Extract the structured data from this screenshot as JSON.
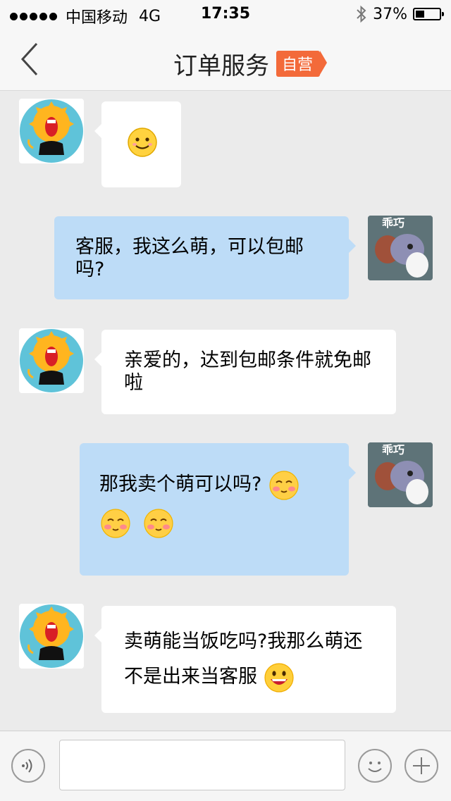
{
  "status_bar": {
    "carrier": "中国移动",
    "network": "4G",
    "time": "17:35",
    "battery": "37%",
    "battery_level": 0.37
  },
  "nav": {
    "title": "订单服务",
    "badge": "自营"
  },
  "messages": [
    {
      "from": "agent",
      "text": ""
    },
    {
      "from": "user",
      "text": "客服，我这么萌，可以包邮吗?"
    },
    {
      "from": "agent",
      "text": "亲爱的，达到包邮条件就免邮啦"
    },
    {
      "from": "user",
      "text": "那我卖个萌可以吗?"
    },
    {
      "from": "agent",
      "text": "卖萌能当饭吃吗?我那么萌还不是出来当客服"
    }
  ],
  "avatar_user_caption": "乖巧",
  "input": {
    "placeholder": ""
  },
  "icons": [
    "back-chevron-icon",
    "bluetooth-icon",
    "voice-icon",
    "emoji-icon",
    "plus-icon",
    "smiley-emoji",
    "blush-emoji",
    "grin-emoji"
  ],
  "colors": {
    "outgoing_bubble": "#bddcf7",
    "incoming_bubble": "#ffffff",
    "badge": "#f36a3a",
    "chat_background": "#ebebeb"
  }
}
